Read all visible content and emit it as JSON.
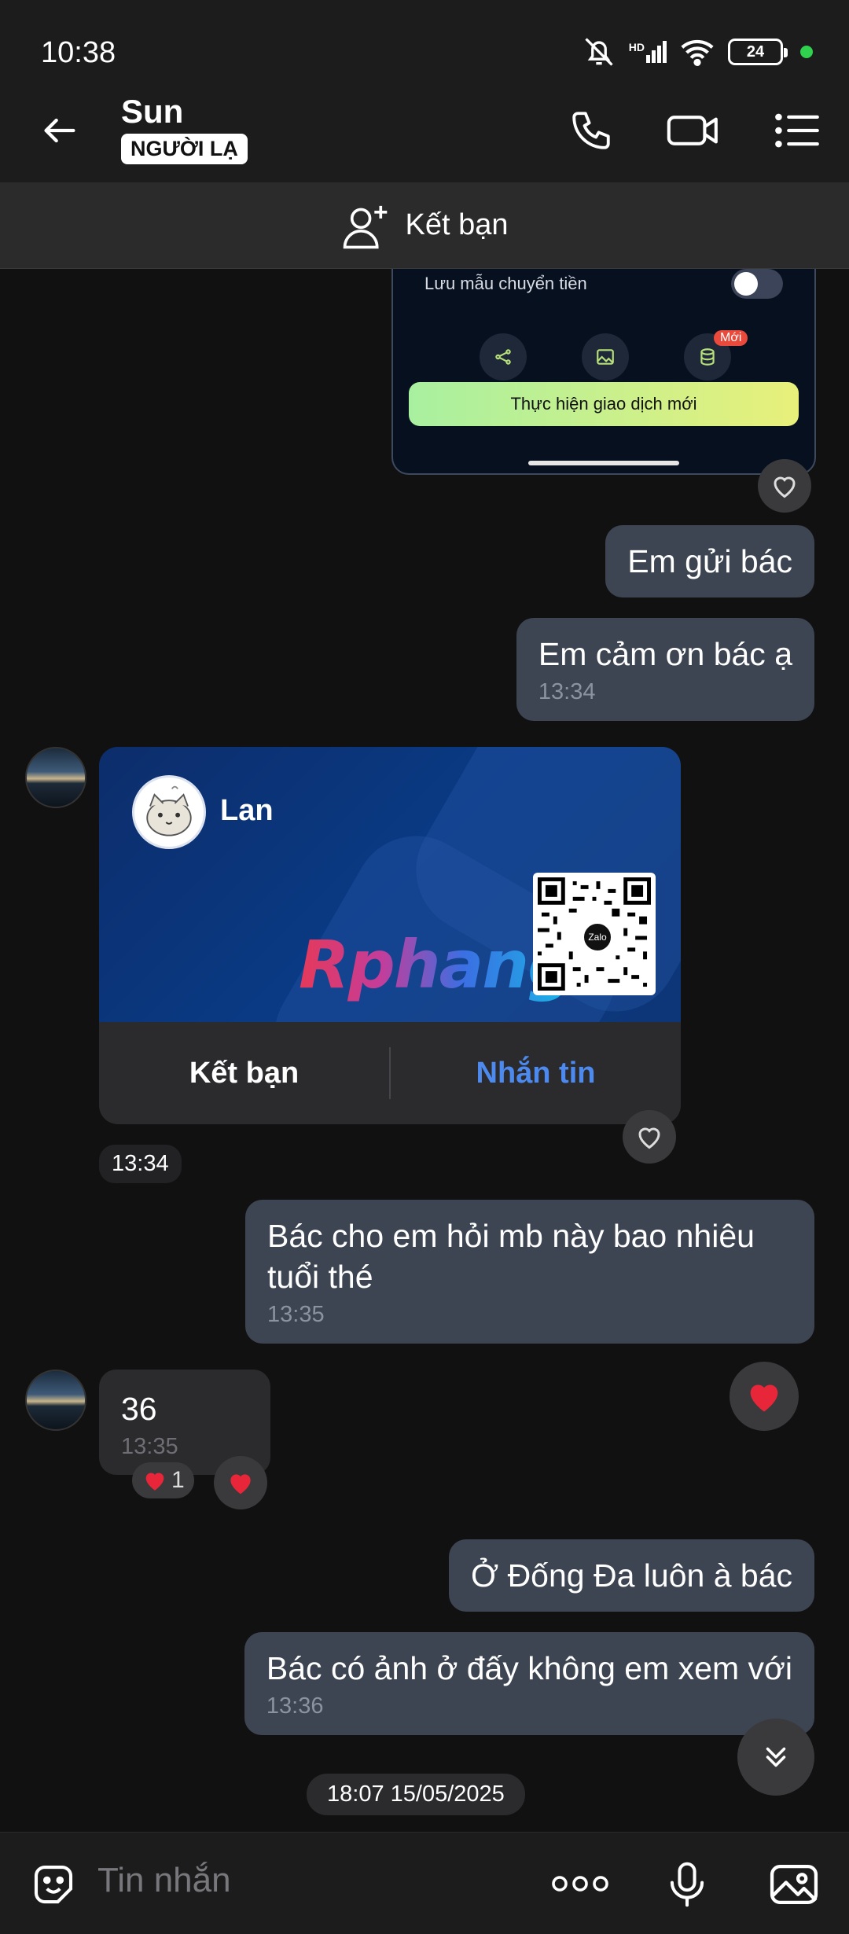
{
  "status_bar": {
    "time": "10:38",
    "signal_label": "HD",
    "battery": "24"
  },
  "header": {
    "name": "Sun",
    "badge": "NGƯỜI LẠ"
  },
  "add_friend": {
    "label": "Kết bạn"
  },
  "shared_screenshot": {
    "toggle_label": "Lưu mẫu chuyển tiền",
    "new_badge": "Mới",
    "button_label": "Thực hiện giao dịch mới"
  },
  "messages": {
    "m1": {
      "text": "Em gửi bác"
    },
    "m2": {
      "text": "Em cảm ơn bác ạ",
      "time": "13:34"
    },
    "contact_card": {
      "name": "Lan",
      "watermark": "Rphang",
      "qr_logo": "Zalo",
      "add_label": "Kết bạn",
      "message_label": "Nhắn tin",
      "time": "13:34"
    },
    "m3": {
      "text": "Bác cho em hỏi mb này bao nhiêu tuổi thé",
      "time": "13:35"
    },
    "m4": {
      "text": "36",
      "time": "13:35",
      "reaction_count": "1"
    },
    "m5": {
      "text": "Ở Đống Đa luôn à bác"
    },
    "m6": {
      "text": "Bác có ảnh ở đấy không em xem với",
      "time": "13:36"
    }
  },
  "date_chip": "18:07 15/05/2025",
  "input": {
    "placeholder": "Tin nhắn"
  },
  "colors": {
    "background": "#111111",
    "outgoing_bubble": "#3d4452",
    "incoming_bubble": "#2b2b2d",
    "accent_blue": "#4d8af0",
    "heart_red": "#e8263a"
  }
}
